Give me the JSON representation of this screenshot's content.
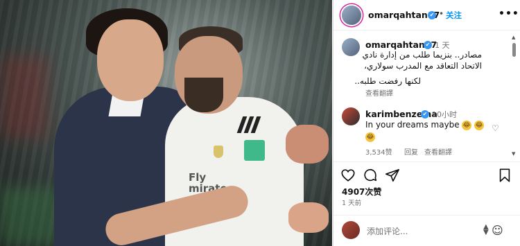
{
  "post": {
    "author": "omarqahtan87",
    "verified_mark": "✔",
    "separator": "•",
    "follow_label": "关注",
    "more_label": "•••"
  },
  "caption": {
    "username": "omarqahtan87",
    "time": "1 天",
    "line1": "مصادر.. بنزيما طلب من إدارة نادي",
    "line2": "الاتحاد التعاقد مع المدرب سولاري،",
    "line3": "لكنها رفضت طلبه..",
    "see_translation": "查看翻譯"
  },
  "comment": {
    "username": "karimbenzema",
    "time": "10小时",
    "text": "In your dreams maybe",
    "emojis": [
      "😂",
      "😂",
      "😂"
    ],
    "likes": "3,534赞",
    "reply_label": "回复",
    "see_translation": "查看翻譯"
  },
  "actions": {
    "like_icon": "heart-icon",
    "comment_icon": "comment-icon",
    "share_icon": "share-icon",
    "save_icon": "bookmark-icon"
  },
  "stats": {
    "likes": "4907次赞",
    "posted": "1 天前"
  },
  "add_comment": {
    "placeholder": "添加评论...",
    "emoji_icon": "smiley-icon"
  },
  "photo": {
    "jersey_sponsor_line1": "Fly",
    "jersey_sponsor_line2": "mirates"
  },
  "colors": {
    "accent": "#0095f6",
    "verified": "#3897f0",
    "muted": "#737373",
    "border": "#dbdbdb"
  }
}
